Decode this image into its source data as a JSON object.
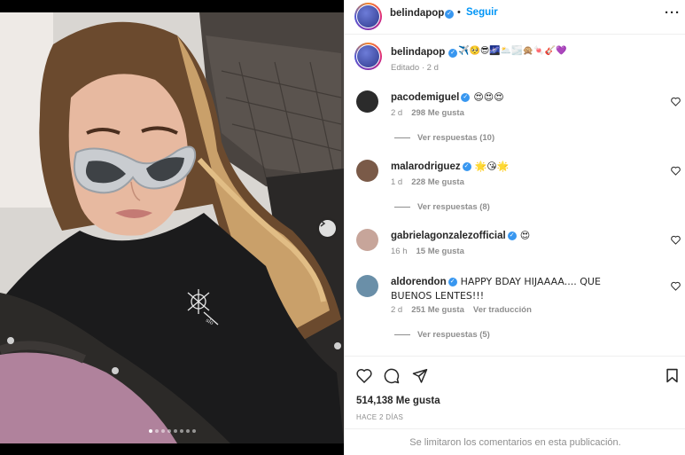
{
  "post": {
    "carousel_dots": 8,
    "active_dot": 0
  },
  "header": {
    "username": "belindapop",
    "separator": "•",
    "follow_label": "Seguir",
    "more_icon": "more-horizontal-icon"
  },
  "caption": {
    "username": "belindapop",
    "emojis": "✈️🥺😎🌌🌥️🌫️🙊🍬🎸💜",
    "edited": "Editado · 2 d"
  },
  "comments": [
    {
      "username": "pacodemiguel",
      "text": "😍😍😍",
      "time": "2 d",
      "likes": "298 Me gusta",
      "replies": "Ver respuestas (10)",
      "avatar_color": "#2b2b2b"
    },
    {
      "username": "malarodriguez",
      "text": "🌟😘🌟",
      "time": "1 d",
      "likes": "228 Me gusta",
      "replies": "Ver respuestas (8)",
      "avatar_color": "#7a5a48"
    },
    {
      "username": "gabrielagonzalezofficial",
      "text": "😍",
      "time": "16 h",
      "likes": "15 Me gusta",
      "replies": "",
      "avatar_color": "#c7a59a"
    },
    {
      "username": "aldorendon",
      "text": "HAPPY BDAY HIJAAAA.... QUE BUENOS LENTES!!!",
      "time": "2 d",
      "likes": "251 Me gusta",
      "translate": "Ver traducción",
      "replies": "Ver respuestas (5)",
      "avatar_color": "#6a8fa8"
    }
  ],
  "actions": {
    "likes_count": "514,138 Me gusta",
    "posted_ago": "HACE 2 DÍAS"
  },
  "footer": {
    "notice": "Se limitaron los comentarios en esta publicación."
  }
}
